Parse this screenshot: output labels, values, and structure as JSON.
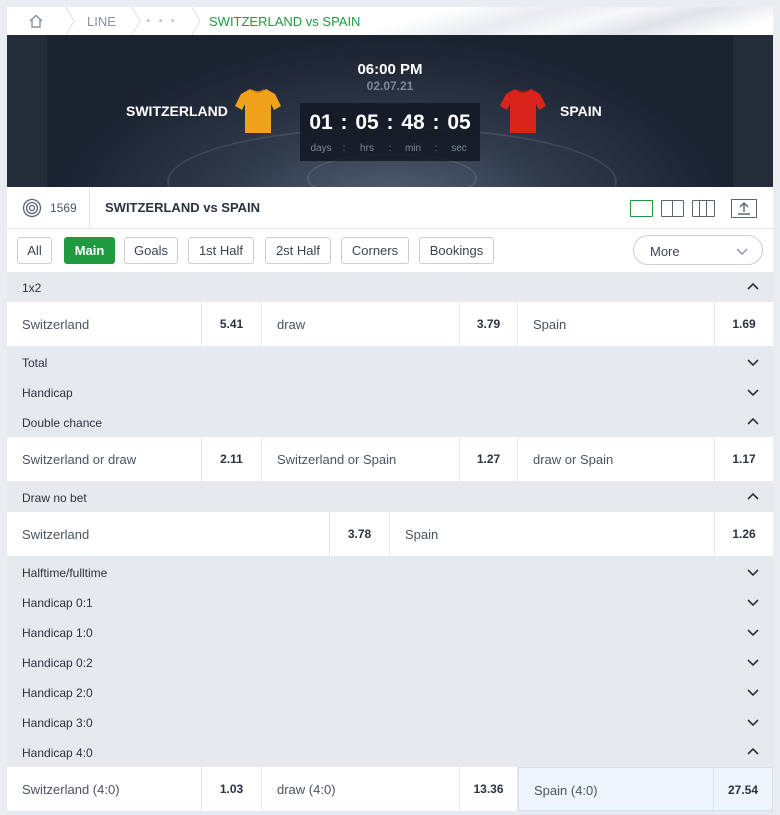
{
  "breadcrumb": {
    "line_label": "LINE",
    "dots_label": "• • •",
    "current_label": "SWITZERLAND vs SPAIN"
  },
  "match": {
    "home_team": "SWITZERLAND",
    "away_team": "SPAIN",
    "time": "06:00 PM",
    "date": "02.07.21",
    "home_shirt_color": "#f0a21b",
    "away_shirt_color": "#d9241b",
    "countdown": {
      "days": "01",
      "hrs": "05",
      "min": "48",
      "sec": "05",
      "days_label": "days",
      "hrs_label": "hrs",
      "min_label": "min",
      "sec_label": "sec",
      "separator": ":",
      "unit_separator": ":"
    }
  },
  "event_bar": {
    "markets_count": "1569",
    "title": "SWITZERLAND vs SPAIN"
  },
  "filters": {
    "tabs": [
      "All",
      "Main",
      "Goals",
      "1st Half",
      "2st Half",
      "Corners",
      "Bookings"
    ],
    "active": "Main",
    "more_label": "More"
  },
  "colors": {
    "accent_green": "#1f9a3f",
    "selected_bg": "#eef5fc"
  },
  "markets": [
    {
      "label": "1x2",
      "expanded": true,
      "rows": [
        [
          {
            "name": "Switzerland",
            "odds": "5.41"
          },
          {
            "name": "draw",
            "odds": "3.79"
          },
          {
            "name": "Spain",
            "odds": "1.69"
          }
        ]
      ]
    },
    {
      "label": "Total",
      "expanded": false,
      "rows": []
    },
    {
      "label": "Handicap",
      "expanded": false,
      "rows": []
    },
    {
      "label": "Double chance",
      "expanded": true,
      "rows": [
        [
          {
            "name": "Switzerland or draw",
            "odds": "2.11"
          },
          {
            "name": "Switzerland or Spain",
            "odds": "1.27"
          },
          {
            "name": "draw or Spain",
            "odds": "1.17"
          }
        ]
      ]
    },
    {
      "label": "Draw no bet",
      "expanded": true,
      "rows": [
        [
          {
            "name": "Switzerland",
            "odds": "3.78"
          },
          {
            "name": "Spain",
            "odds": "1.26"
          }
        ]
      ]
    },
    {
      "label": "Halftime/fulltime",
      "expanded": false,
      "rows": []
    },
    {
      "label": "Handicap 0:1",
      "expanded": false,
      "rows": []
    },
    {
      "label": "Handicap 1:0",
      "expanded": false,
      "rows": []
    },
    {
      "label": "Handicap 0:2",
      "expanded": false,
      "rows": []
    },
    {
      "label": "Handicap 2:0",
      "expanded": false,
      "rows": []
    },
    {
      "label": "Handicap 3:0",
      "expanded": false,
      "rows": []
    },
    {
      "label": "Handicap 4:0",
      "expanded": true,
      "rows": [
        [
          {
            "name": "Switzerland (4:0)",
            "odds": "1.03"
          },
          {
            "name": "draw (4:0)",
            "odds": "13.36"
          },
          {
            "name": "Spain (4:0)",
            "odds": "27.54",
            "selected": true
          }
        ]
      ]
    }
  ]
}
